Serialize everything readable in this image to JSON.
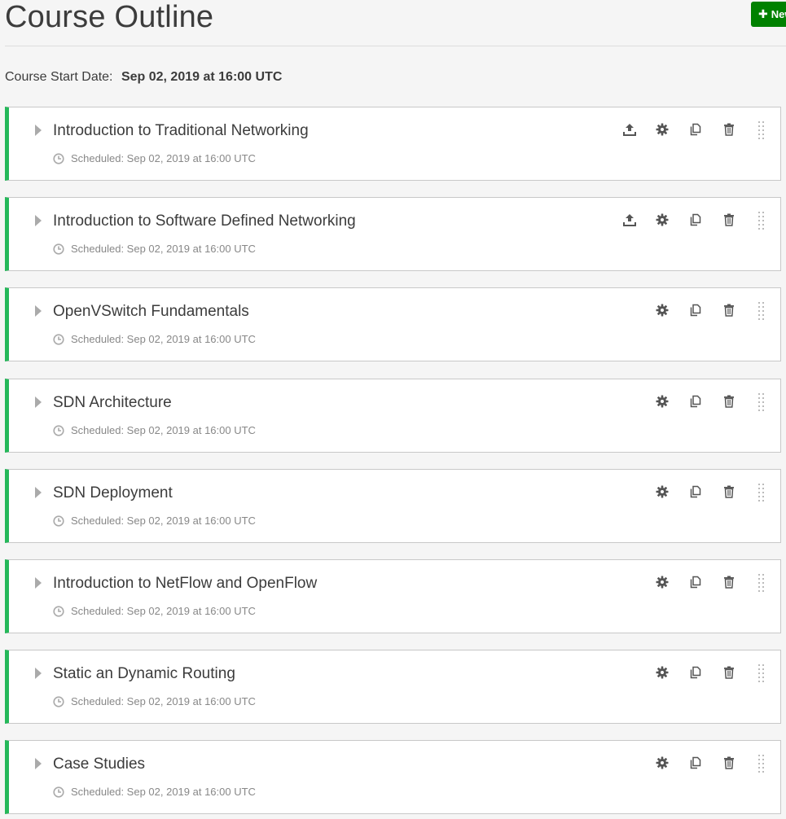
{
  "page": {
    "title": "Course Outline",
    "new_button_label": "New"
  },
  "course": {
    "start_date_label": "Course Start Date:",
    "start_date_value": "Sep 02, 2019 at 16:00 UTC"
  },
  "sections": [
    {
      "title": "Introduction to Traditional Networking",
      "scheduled": "Scheduled: Sep 02, 2019 at 16:00 UTC",
      "has_publish": true
    },
    {
      "title": "Introduction to Software Defined Networking",
      "scheduled": "Scheduled: Sep 02, 2019 at 16:00 UTC",
      "has_publish": true
    },
    {
      "title": "OpenVSwitch Fundamentals",
      "scheduled": "Scheduled: Sep 02, 2019 at 16:00 UTC",
      "has_publish": false
    },
    {
      "title": "SDN Architecture",
      "scheduled": "Scheduled: Sep 02, 2019 at 16:00 UTC",
      "has_publish": false
    },
    {
      "title": "SDN Deployment",
      "scheduled": "Scheduled: Sep 02, 2019 at 16:00 UTC",
      "has_publish": false
    },
    {
      "title": "Introduction to NetFlow and OpenFlow",
      "scheduled": "Scheduled: Sep 02, 2019 at 16:00 UTC",
      "has_publish": false
    },
    {
      "title": "Static an Dynamic Routing",
      "scheduled": "Scheduled: Sep 02, 2019 at 16:00 UTC",
      "has_publish": false
    },
    {
      "title": "Case Studies",
      "scheduled": "Scheduled: Sep 02, 2019 at 16:00 UTC",
      "has_publish": false
    }
  ],
  "icons": {
    "expand": "caret-right-icon",
    "clock": "clock-icon",
    "publish": "upload-icon",
    "settings": "gear-icon",
    "duplicate": "copy-icon",
    "delete": "trash-icon",
    "drag": "drag-handle-icon"
  },
  "colors": {
    "accent_green": "#008100",
    "section_border_green": "#25b85a"
  }
}
